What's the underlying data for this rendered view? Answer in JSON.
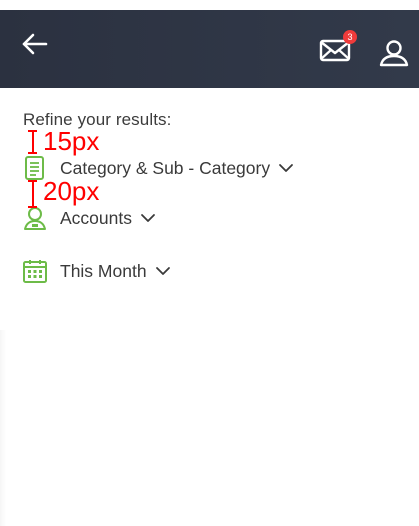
{
  "header": {
    "notification_count": "3",
    "background_color": "#2b3140",
    "badge_color": "#ef3b3b"
  },
  "filters": {
    "title": "Refine your results:",
    "items": [
      {
        "label": "Category & Sub - Category",
        "icon": "document-icon"
      },
      {
        "label": "Accounts",
        "icon": "user-account-icon"
      },
      {
        "label": "This Month",
        "icon": "calendar-icon"
      }
    ],
    "icon_color": "#6dbb48"
  },
  "annotations": {
    "gap_1": "15px",
    "gap_2": "20px",
    "color": "#ff0000"
  }
}
